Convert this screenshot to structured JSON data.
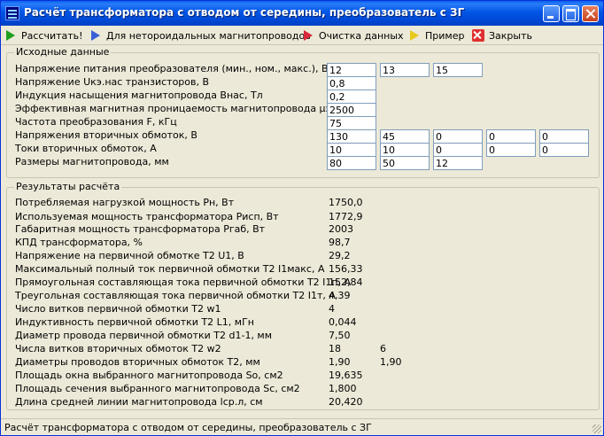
{
  "window": {
    "title": "Расчёт трансформатора с отводом от середины, преобразователь с ЗГ",
    "accent": "#0055e5"
  },
  "toolbar": {
    "calculate": "Рассчитать!",
    "non_toroidal": "Для нетороидальных магнитопроводов",
    "clear": "Очистка данных",
    "example": "Пример",
    "close": "Закрыть"
  },
  "input": {
    "title": "Исходные данные",
    "rows": [
      {
        "label": "Напряжение питания преобразователя (мин., ном., макс.), В",
        "values": [
          "12",
          "13",
          "15"
        ]
      },
      {
        "label": "Напряжение Uкэ.нас транзисторов, В",
        "values": [
          "0,8"
        ]
      },
      {
        "label": "Индукция насыщения магнитопровода Bнас, Тл",
        "values": [
          "0,2"
        ]
      },
      {
        "label": "Эффективная магнитная проницаемость магнитопровода μэфф",
        "values": [
          "2500"
        ]
      },
      {
        "label": "Частота преобразования F, кГц",
        "values": [
          "75"
        ]
      },
      {
        "label": "Напряжения вторичных обмоток, В",
        "values": [
          "130",
          "45",
          "0",
          "0",
          "0"
        ]
      },
      {
        "label": "Токи вторичных обмоток, А",
        "values": [
          "10",
          "10",
          "0",
          "0",
          "0"
        ]
      },
      {
        "label": "Размеры магнитопровода, мм",
        "values": [
          "80",
          "50",
          "12"
        ]
      }
    ]
  },
  "results": {
    "title": "Результаты расчёта",
    "rows": [
      {
        "label": "Потребляемая нагрузкой мощность Pн, Вт",
        "values": [
          "1750,0"
        ]
      },
      {
        "label": "Используемая мощность трансформатора Pисп, Вт",
        "values": [
          "1772,9"
        ]
      },
      {
        "label": "Габаритная мощность трансформатора Pгаб, Вт",
        "values": [
          "2003"
        ]
      },
      {
        "label": "КПД трансформатора, %",
        "values": [
          "98,7"
        ]
      },
      {
        "label": "Напряжение на первичной обмотке T2 U1, В",
        "values": [
          "29,2"
        ]
      },
      {
        "label": "Максимальный полный ток первичной обмотки T2 I1макс, А",
        "values": [
          "156,33"
        ]
      },
      {
        "label": "Прямоугольная составляющая тока первичной обмотки T2 I1п, А",
        "values": [
          "152,84"
        ]
      },
      {
        "label": "Треугольная составляющая тока первичной обмотки T2 I1т, А",
        "values": [
          "4,39"
        ]
      },
      {
        "label": "Число витков первичной обмотки T2 w1",
        "values": [
          "4"
        ]
      },
      {
        "label": "Индуктивность первичной обмотки T2 L1, мГн",
        "values": [
          "0,044"
        ]
      },
      {
        "label": "Диаметр провода первичной обмотки T2 d1-1, мм",
        "values": [
          "7,50"
        ]
      },
      {
        "label": "Числа витков вторичных обмоток T2 w2",
        "values": [
          "18",
          "6"
        ]
      },
      {
        "label": "Диаметры проводов вторичных обмоток T2, мм",
        "values": [
          "1,90",
          "1,90"
        ]
      },
      {
        "label": "Площадь окна выбранного магнитопровода So, см2",
        "values": [
          "19,635"
        ]
      },
      {
        "label": "Площадь сечения выбранного магнитопровода Sc, см2",
        "values": [
          "1,800"
        ]
      },
      {
        "label": "Длина средней линии магнитопровода lср.л, см",
        "values": [
          "20,420"
        ]
      }
    ]
  },
  "statusbar": {
    "text": "Расчёт трансформатора с отводом от середины, преобразователь с ЗГ"
  }
}
